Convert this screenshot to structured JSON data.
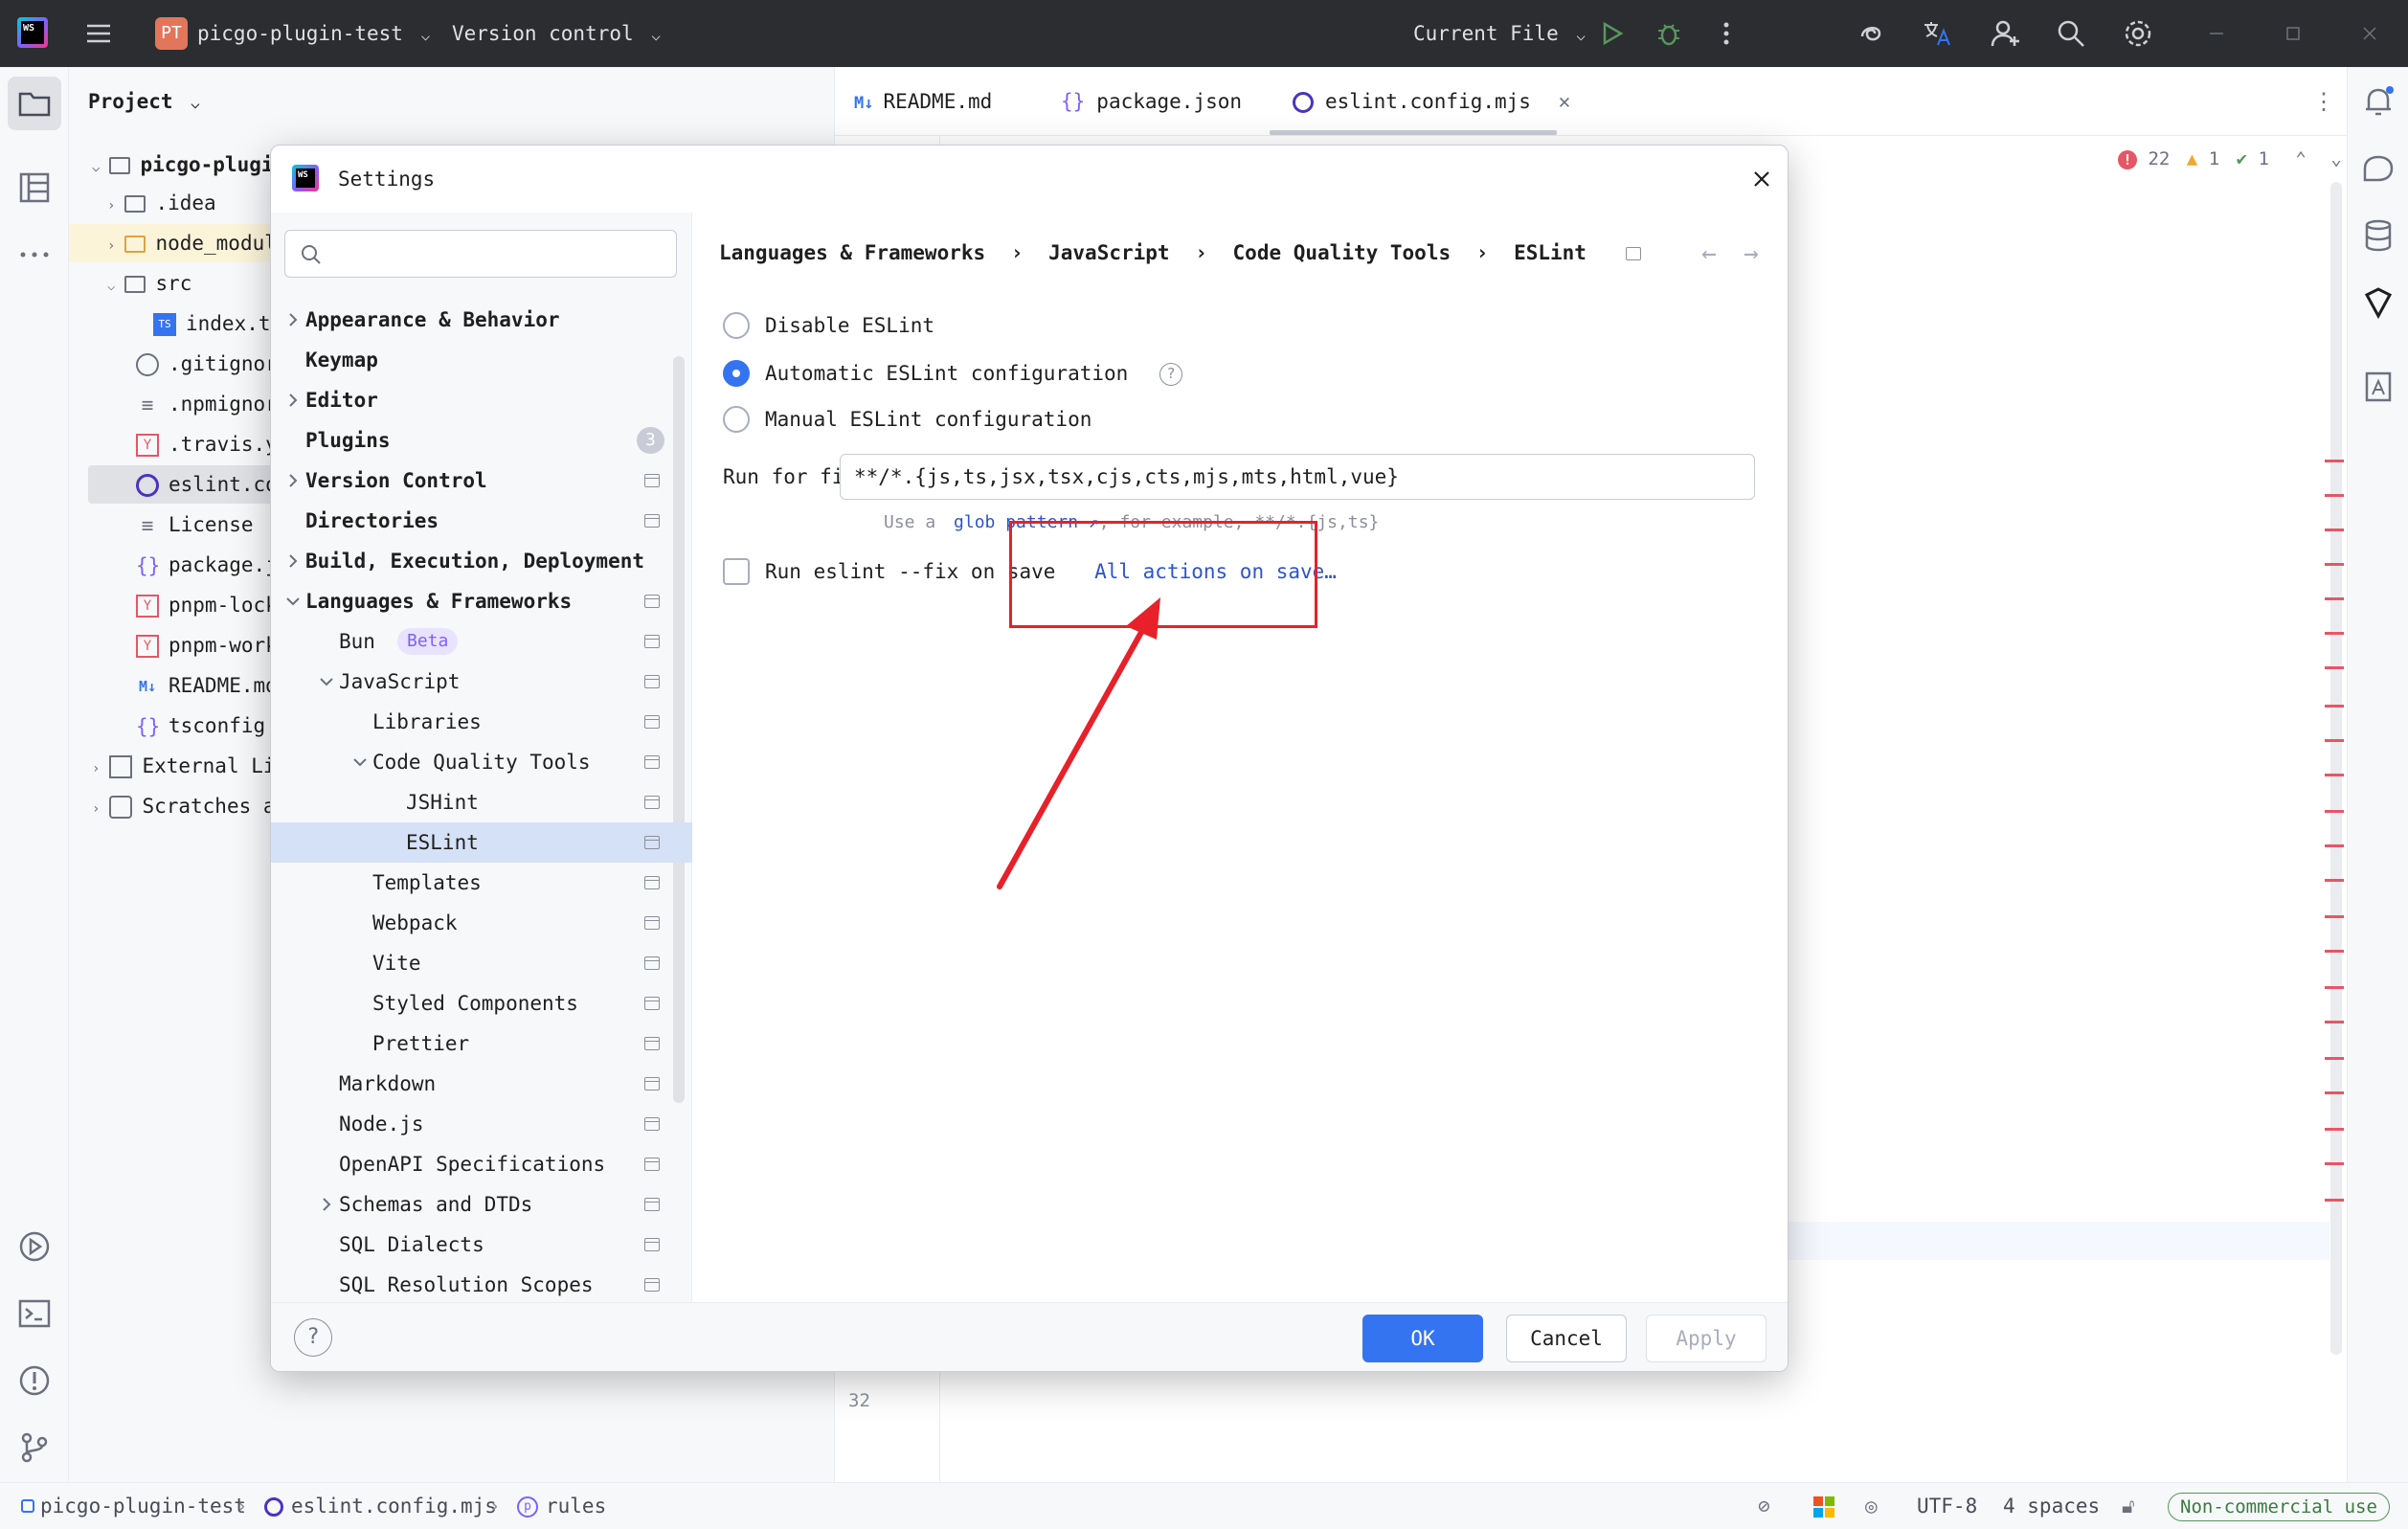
{
  "titlebar": {
    "app_badge": "PT",
    "project_name": "picgo-plugin-test",
    "vcs": "Version control",
    "run_config": "Current File"
  },
  "project_panel": {
    "title": "Project",
    "items": [
      {
        "label": "picgo-plugin-test"
      },
      {
        "label": ".idea"
      },
      {
        "label": "node_modules"
      },
      {
        "label": "src"
      },
      {
        "label": "index.ts"
      },
      {
        "label": ".gitignore"
      },
      {
        "label": ".npmignore"
      },
      {
        "label": ".travis.yml"
      },
      {
        "label": "eslint.config.mjs"
      },
      {
        "label": "License"
      },
      {
        "label": "package.json"
      },
      {
        "label": "pnpm-lock.yaml"
      },
      {
        "label": "pnpm-workspace.yaml"
      },
      {
        "label": "README.md"
      },
      {
        "label": "tsconfig.json"
      },
      {
        "label": "External Libraries"
      },
      {
        "label": "Scratches and Consoles"
      }
    ]
  },
  "editor": {
    "tabs": [
      {
        "label": "README.md"
      },
      {
        "label": "package.json"
      },
      {
        "label": "eslint.config.mjs"
      }
    ],
    "inspections": {
      "errors": "22",
      "warnings": "1",
      "ok": "1"
    },
    "line_number": "32"
  },
  "dialog": {
    "title": "Settings",
    "search_placeholder": "",
    "breadcrumb": [
      "Languages & Frameworks",
      "JavaScript",
      "Code Quality Tools",
      "ESLint"
    ],
    "breadcrumb_sep": "›",
    "nav": [
      {
        "label": "Appearance & Behavior"
      },
      {
        "label": "Keymap"
      },
      {
        "label": "Editor"
      },
      {
        "label": "Plugins",
        "badge": "3"
      },
      {
        "label": "Version Control"
      },
      {
        "label": "Directories"
      },
      {
        "label": "Build, Execution, Deployment"
      },
      {
        "label": "Languages & Frameworks"
      },
      {
        "label": "Bun",
        "badge": "Beta"
      },
      {
        "label": "JavaScript"
      },
      {
        "label": "Libraries"
      },
      {
        "label": "Code Quality Tools"
      },
      {
        "label": "JSHint"
      },
      {
        "label": "ESLint"
      },
      {
        "label": "Templates"
      },
      {
        "label": "Webpack"
      },
      {
        "label": "Vite"
      },
      {
        "label": "Styled Components"
      },
      {
        "label": "Prettier"
      },
      {
        "label": "Markdown"
      },
      {
        "label": "Node.js"
      },
      {
        "label": "OpenAPI Specifications"
      },
      {
        "label": "Schemas and DTDs"
      },
      {
        "label": "SQL Dialects"
      },
      {
        "label": "SQL Resolution Scopes"
      }
    ],
    "options": {
      "disable": "Disable ESLint",
      "automatic": "Automatic ESLint configuration",
      "manual": "Manual ESLint configuration",
      "selected": "automatic"
    },
    "run_for_files_label": "Run for files:",
    "run_for_files_value": "**/*.{js,ts,jsx,tsx,cjs,cts,mjs,mts,html,vue}",
    "hint_prefix": "Use a",
    "hint_link": "glob pattern",
    "hint_suffix": ", for example, **/*.{js,ts}",
    "fix_on_save_label": "Run eslint --fix on save",
    "fix_on_save_checked": false,
    "all_actions_link": "All actions on save…",
    "buttons": {
      "ok": "OK",
      "cancel": "Cancel",
      "apply": "Apply"
    }
  },
  "statusbar": {
    "path": [
      "picgo-plugin-test",
      "eslint.config.mjs",
      "rules"
    ],
    "encoding": "UTF-8",
    "indent": "4 spaces",
    "license": "Non-commercial use"
  },
  "colors": {
    "accent": "#3574f0",
    "annotation_red": "#e8202a",
    "selection": "#d5e1f7",
    "link": "#2e55c7"
  }
}
